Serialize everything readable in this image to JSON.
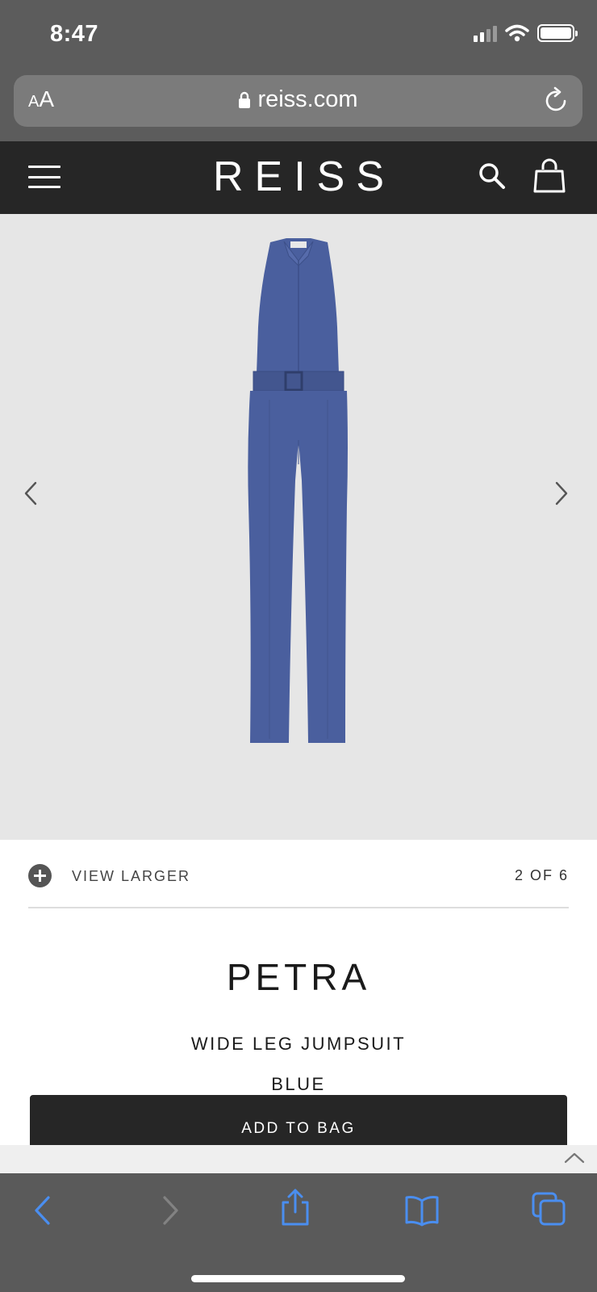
{
  "status_bar": {
    "time": "8:47"
  },
  "browser": {
    "text_size_label": "AA",
    "url": "reiss.com"
  },
  "site": {
    "logo": "REISS"
  },
  "gallery": {
    "view_larger_label": "VIEW LARGER",
    "counter": "2 OF 6",
    "current_image": 2,
    "total_images": 6
  },
  "product": {
    "name": "PETRA",
    "description": "WIDE LEG JUMPSUIT",
    "color": "BLUE",
    "add_to_bag_label": "ADD TO BAG"
  },
  "colors": {
    "header_bg": "#262626",
    "gallery_bg": "#e6e6e6",
    "product_blue": "#4a5f9e",
    "safari_accent": "#4a8ef0"
  },
  "icons": {
    "status": [
      "signal-icon",
      "wifi-icon",
      "battery-icon"
    ],
    "browser": [
      "lock-icon",
      "reload-icon"
    ],
    "header": [
      "hamburger-menu-icon",
      "search-icon",
      "shopping-bag-icon"
    ],
    "gallery": [
      "chevron-left-icon",
      "chevron-right-icon",
      "plus-circle-icon"
    ],
    "toolbar": [
      "back-icon",
      "forward-icon",
      "share-icon",
      "bookmarks-icon",
      "tabs-icon"
    ]
  }
}
